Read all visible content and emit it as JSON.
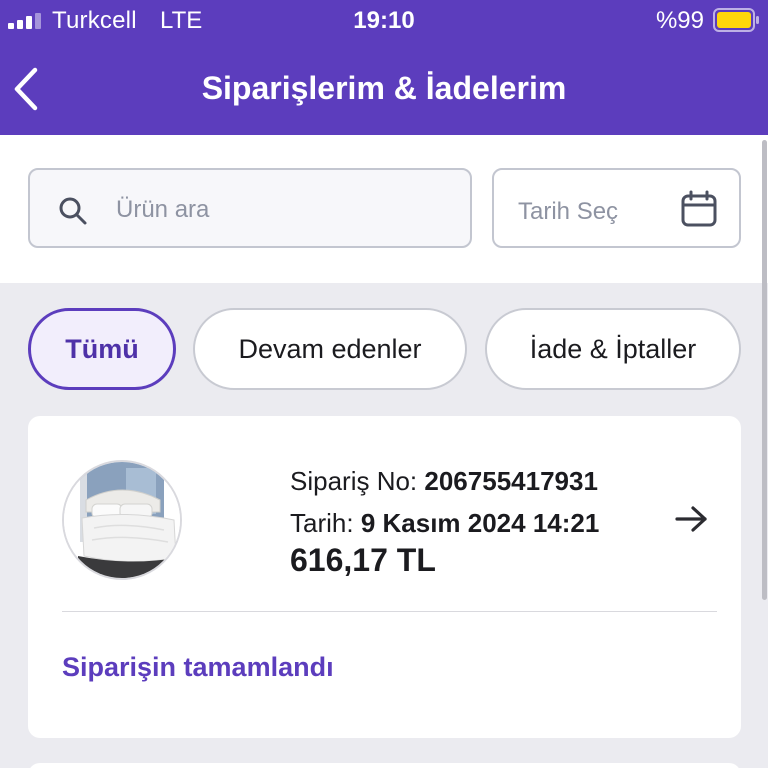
{
  "status_bar": {
    "carrier": "Turkcell",
    "network": "LTE",
    "time": "19:10",
    "battery_percent": "%99",
    "battery_color": "#ffd60a"
  },
  "nav": {
    "back_icon": "chevron-left-icon",
    "title": "Siparişlerim & İadelerim"
  },
  "search": {
    "placeholder": "Ürün ara",
    "icon": "search-icon"
  },
  "date_picker": {
    "label": "Tarih Seç",
    "icon": "calendar-icon"
  },
  "filters": [
    {
      "label": "Tümü",
      "active": true
    },
    {
      "label": "Devam edenler",
      "active": false
    },
    {
      "label": "İade & İptaller",
      "active": false
    }
  ],
  "orders": [
    {
      "order_no_label": "Sipariş No:",
      "order_no": "206755417931",
      "date_label": "Tarih:",
      "date": "9 Kasım 2024 14:21",
      "total": "616,17 TL",
      "status": "Siparişin tamamlandı",
      "product_image": "bed-duvet-product-image"
    }
  ],
  "colors": {
    "accent": "#5c3dbd",
    "background": "#ebebf0",
    "card": "#ffffff"
  }
}
